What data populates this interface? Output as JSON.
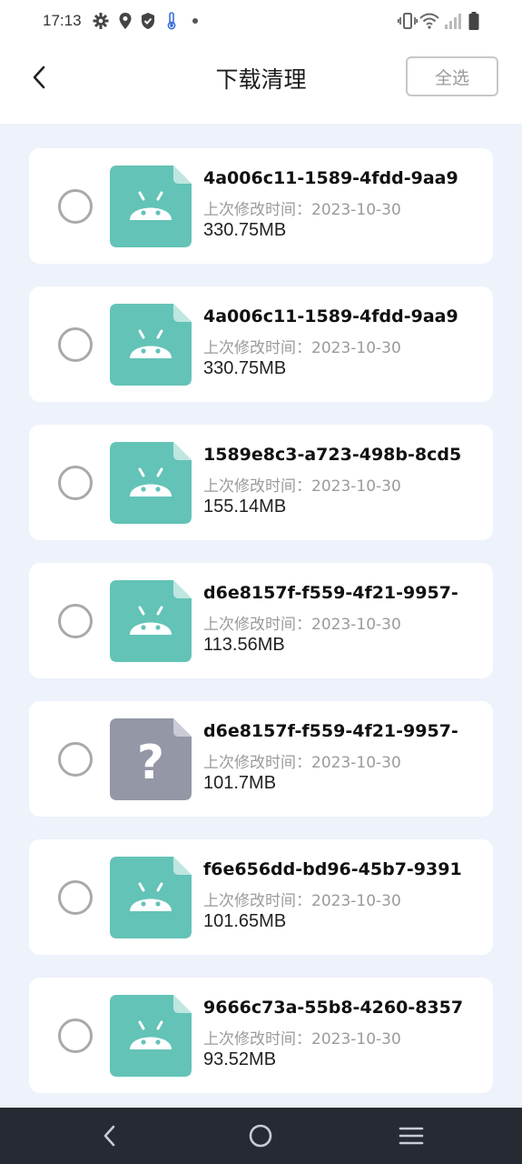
{
  "status_bar": {
    "time": "17:13",
    "left_icons": [
      "gear-icon",
      "location-icon",
      "shield-icon",
      "thermometer-icon",
      "dot-icon"
    ],
    "right_icons": [
      "vibrate-icon",
      "wifi-icon",
      "signal-icon",
      "battery-icon"
    ]
  },
  "header": {
    "back_icon": "chevron-left-icon",
    "title": "下载清理",
    "select_all_label": "全选"
  },
  "colors": {
    "apk_icon": "#63c3b7",
    "unknown_icon": "#9397a6",
    "page_bg": "#eef2fb",
    "nav_bg": "#252a33"
  },
  "files": [
    {
      "name": "4a006c11-1589-4fdd-9aa9",
      "date_label": "上次修改时间：",
      "date": "2023-10-30",
      "size": "330.75MB",
      "icon": "android-apk-icon"
    },
    {
      "name": "4a006c11-1589-4fdd-9aa9",
      "date_label": "上次修改时间：",
      "date": "2023-10-30",
      "size": "330.75MB",
      "icon": "android-apk-icon"
    },
    {
      "name": "1589e8c3-a723-498b-8cd5",
      "date_label": "上次修改时间：",
      "date": "2023-10-30",
      "size": "155.14MB",
      "icon": "android-apk-icon"
    },
    {
      "name": "d6e8157f-f559-4f21-9957-",
      "date_label": "上次修改时间：",
      "date": "2023-10-30",
      "size": "113.56MB",
      "icon": "android-apk-icon"
    },
    {
      "name": "d6e8157f-f559-4f21-9957-",
      "date_label": "上次修改时间：",
      "date": "2023-10-30",
      "size": "101.7MB",
      "icon": "unknown-file-icon"
    },
    {
      "name": "f6e656dd-bd96-45b7-9391",
      "date_label": "上次修改时间：",
      "date": "2023-10-30",
      "size": "101.65MB",
      "icon": "android-apk-icon"
    },
    {
      "name": "9666c73a-55b8-4260-8357",
      "date_label": "上次修改时间：",
      "date": "2023-10-30",
      "size": "93.52MB",
      "icon": "android-apk-icon"
    }
  ],
  "nav_bar": {
    "icons": [
      "nav-back-icon",
      "nav-home-icon",
      "nav-menu-icon"
    ]
  }
}
